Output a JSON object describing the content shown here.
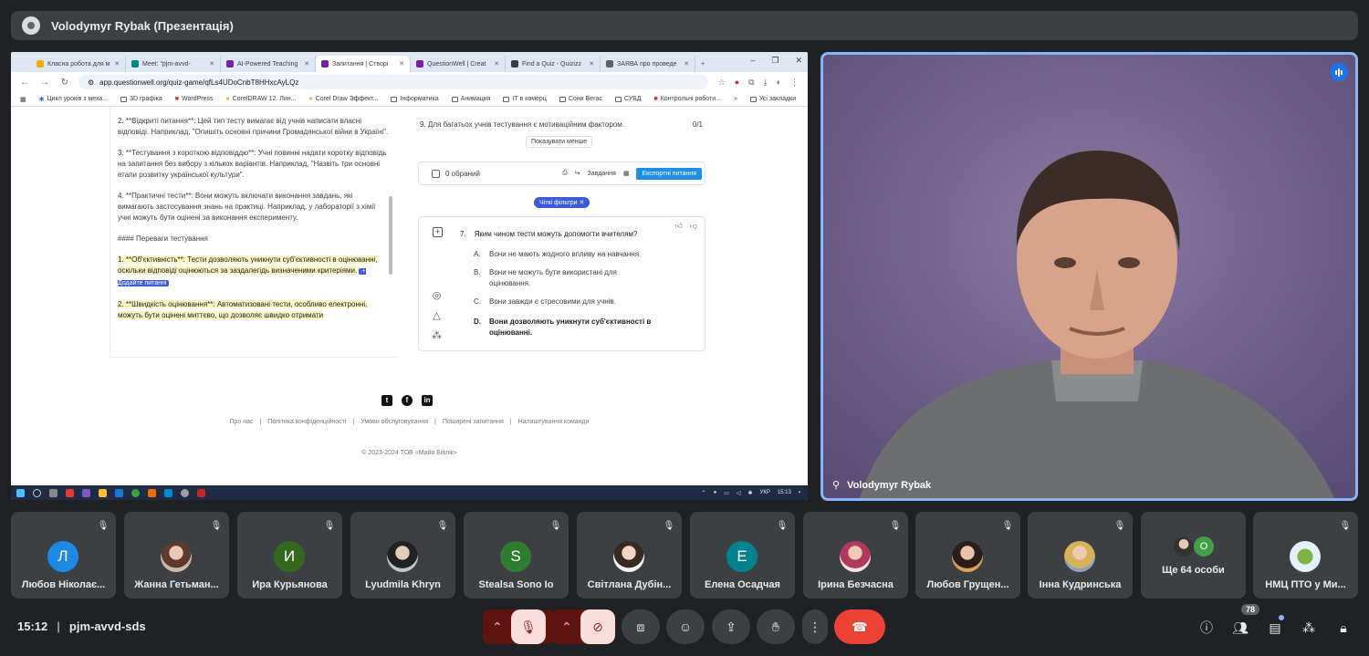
{
  "topbar": {
    "title": "Volodymyr Rybak (Презентація)"
  },
  "browser": {
    "tabs": [
      {
        "label": "Класна робота для м",
        "color": "#f9ab00"
      },
      {
        "label": "Meet: \"pjm-avvd-",
        "color": "#00897b"
      },
      {
        "label": "AI-Powered Teaching",
        "color": "#7b1fa2"
      },
      {
        "label": "Запитання | Створі",
        "color": "#7b1fa2"
      },
      {
        "label": "QuestionWell | Creat",
        "color": "#7b1fa2"
      },
      {
        "label": "Find a Quiz - Quizizz",
        "color": "#3c3c3c"
      },
      {
        "label": "ЗАЯВА про проведе",
        "color": "#5f6368"
      }
    ],
    "url": "app.questionwell.org/quiz-game/qfLs4UDoCnbT8HHxcAyLQz",
    "bookmarks": [
      "Цикл уроків з меха...",
      "3D графіка",
      "WordPress",
      "CorelDRAW 12. Лин...",
      "Corel Draw Эффект...",
      "Інформатика",
      "Анимация",
      "IT в комерц",
      "Сони Вегас",
      "СУБД",
      "Контрольні роботи...",
      "Усі закладки"
    ]
  },
  "left_text": {
    "p1": "2. **Відкриті питання**: Цей тип тесту вимагає від учнів написати власні відповіді. Наприклад, \"Опишіть основні причини Громадянської війни в Україні\".",
    "p2": "3. **Тестування з короткою відповіддю**: Учні повинні надати коротку відповідь на запитання без вибору з кількох варіантів. Наприклад, \"Назвіть три основні етапи розвитку української культури\".",
    "p3": "4. **Практичні тести**: Вони можуть включати виконання завдань, які вимагають застосування знань на практиці. Наприклад, у лабораторії з хімії учні можуть бути оцінені за виконання експерименту.",
    "p4": "#### Переваги тестування",
    "p5": "1. **Об'єктивність**: Тести дозволяють уникнути суб'єктивності в оцінюванні, оскільки відповіді оцінюються за заздалегідь визначеними критеріями.",
    "add_question": "+ Додайте питанні",
    "p6": "2. **Швидкість оцінювання**: Автоматизовані тести, особливо електронні, можуть бути оцінені миттєво, що дозволяє швидко отримати"
  },
  "right_panel": {
    "q9": "9. Для багатьох учнів тестування є мотиваційним фактором.",
    "q9_score": "0/1",
    "show_less": "Показувати менше",
    "selected": "0 обраний",
    "tasks": "Завдання",
    "export": "Експортні питання",
    "filter_chip": "Чіткі фільтри",
    "question_num": "7.",
    "question": "Яким чином тести можуть допомогти вчителям?",
    "options": [
      {
        "letter": "A.",
        "text": "Вони не мають жодного впливу на навчання."
      },
      {
        "letter": "B.",
        "text": "Вони не можуть бути використані для оцінювання."
      },
      {
        "letter": "C.",
        "text": "Вони завжди є стресовими для учнів."
      },
      {
        "letter": "D.",
        "text": "Вони дозволяють уникнути суб'єктивності в оцінюванні."
      }
    ]
  },
  "footer": {
    "links": [
      "Про нас",
      "Політика конфіденційності",
      "Умови обслуговування",
      "Поширені запитання",
      "Налаштування команди"
    ],
    "copyright": "© 2023-2024 ТОВ «Майя Біалік»"
  },
  "taskbar": {
    "lang": "УКР",
    "time": "15:13"
  },
  "speaker": {
    "name": "Volodymyr Rybak"
  },
  "participants": [
    {
      "name": "Любов Ніколає...",
      "initial": "Л",
      "color": "#1e88e5"
    },
    {
      "name": "Жанна Гетьман...",
      "initial": "",
      "color": ""
    },
    {
      "name": "Ира Курьянова",
      "initial": "И",
      "color": "#33691e"
    },
    {
      "name": "Lyudmila Khryn",
      "initial": "",
      "color": ""
    },
    {
      "name": "Stealsa Sono Io",
      "initial": "S",
      "color": "#2e7d32"
    },
    {
      "name": "Світлана Дубін...",
      "initial": "",
      "color": ""
    },
    {
      "name": "Елена Осадчая",
      "initial": "Е",
      "color": "#00838f"
    },
    {
      "name": "Ірина Безчасна",
      "initial": "",
      "color": ""
    },
    {
      "name": "Любов Грущен...",
      "initial": "",
      "color": ""
    },
    {
      "name": "Інна Кудринська",
      "initial": "",
      "color": ""
    }
  ],
  "more_people": {
    "label": "Ще 64 особи",
    "initial": "О"
  },
  "last_tile": {
    "name": "НМЦ ПТО у Ми..."
  },
  "bottom": {
    "time": "15:12",
    "meeting_code": "pjm-avvd-sds",
    "people_count": "78"
  }
}
